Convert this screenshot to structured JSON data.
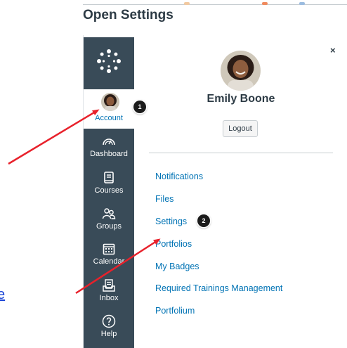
{
  "page": {
    "heading": "Open Settings",
    "left_link_fragment": "e"
  },
  "global_nav": {
    "logo_icon": "canvas-logo-icon",
    "account": {
      "label": "Account",
      "icon": "avatar"
    },
    "items": [
      {
        "label": "Dashboard",
        "icon": "dashboard-icon"
      },
      {
        "label": "Courses",
        "icon": "courses-icon"
      },
      {
        "label": "Groups",
        "icon": "groups-icon"
      },
      {
        "label": "Calendar",
        "icon": "calendar-icon"
      },
      {
        "label": "Inbox",
        "icon": "inbox-icon"
      },
      {
        "label": "Help",
        "icon": "help-icon"
      }
    ]
  },
  "tray": {
    "close_label": "×",
    "user_name": "Emily Boone",
    "logout_label": "Logout",
    "links": [
      {
        "label": "Notifications"
      },
      {
        "label": "Files"
      },
      {
        "label": "Settings"
      },
      {
        "label": "Portfolios"
      },
      {
        "label": "My Badges"
      },
      {
        "label": "Required Trainings Management"
      },
      {
        "label": "Portfolium"
      }
    ]
  },
  "callouts": [
    {
      "number": "1"
    },
    {
      "number": "2"
    }
  ],
  "colors": {
    "nav_bg": "#394b58",
    "link": "#0374b5",
    "arrow": "#e8212b",
    "heading": "#2d3b45"
  }
}
